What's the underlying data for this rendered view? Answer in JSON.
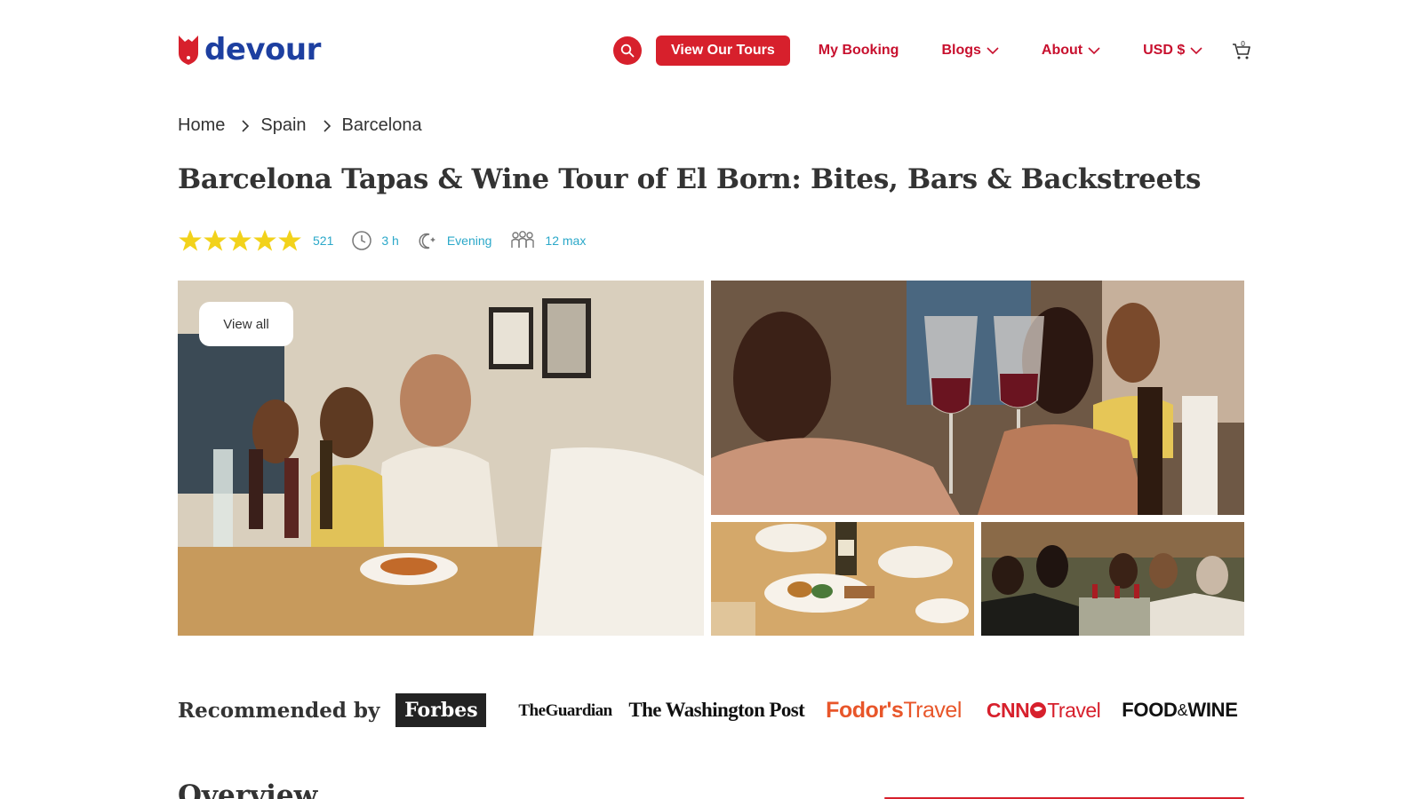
{
  "brand": {
    "name": "devour",
    "color": "#1d3fa0",
    "accent": "#d7202c"
  },
  "header": {
    "search_icon": "search-icon",
    "cta_label": "View Our Tours",
    "my_booking": "My Booking",
    "blogs": "Blogs",
    "about": "About",
    "currency": "USD $",
    "cart_icon": "cart-icon"
  },
  "breadcrumb": [
    "Home",
    "Spain",
    "Barcelona"
  ],
  "tour": {
    "title": "Barcelona Tapas & Wine Tour of El Born: Bites, Bars & Backstreets",
    "rating_stars": 5,
    "reviews": "521",
    "duration": "3 h",
    "time_of_day": "Evening",
    "group_size": "12 max"
  },
  "gallery": {
    "view_all": "View all"
  },
  "recommended": {
    "label": "Recommended by",
    "press": {
      "forbes": "Forbes",
      "guardian_line1": "The",
      "guardian_line2": "Guardian",
      "wapo": "The Washington Post",
      "fodors_a": "Fodor's",
      "fodors_b": "Travel",
      "cnn_a": "CNN",
      "cnn_b": "Travel",
      "food_wine_a": "FOOD",
      "food_wine_amp": "&",
      "food_wine_b": "WINE"
    }
  },
  "overview": {
    "heading": "Overview"
  }
}
